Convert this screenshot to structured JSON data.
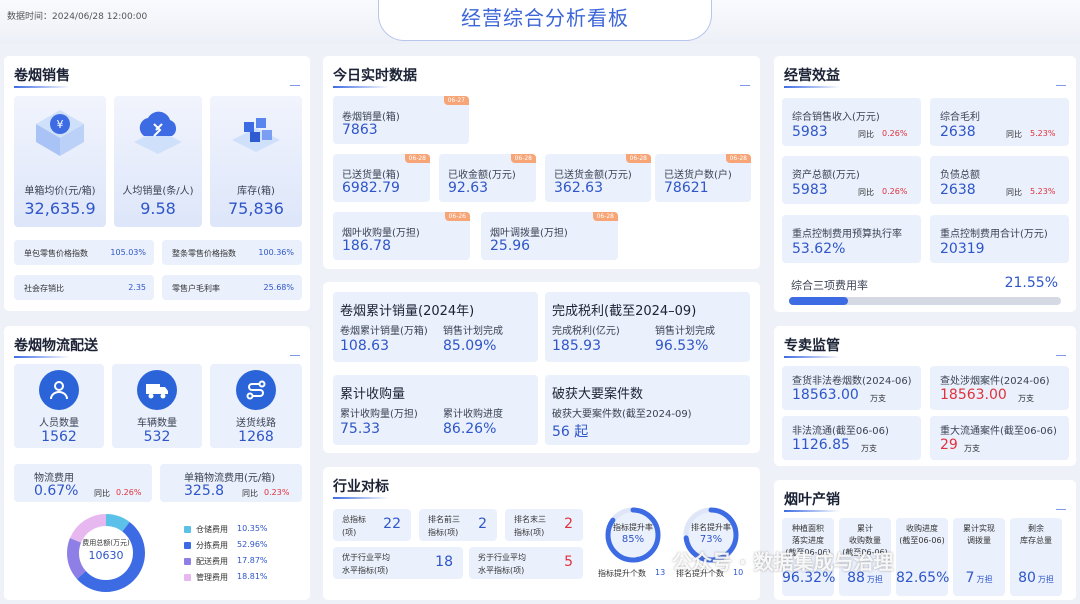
{
  "header": {
    "time_label": "数据时间：",
    "time_value": "2024/06/28  12:00:00",
    "title": "经营综合分析看板"
  },
  "sales": {
    "title": "卷烟销售",
    "kpis": [
      {
        "label": "单箱均价(元/箱)",
        "value": "32,635.9",
        "icon": "money-bag-icon"
      },
      {
        "label": "人均销量(条/人)",
        "value": "9.58",
        "icon": "cloud-icon"
      },
      {
        "label": "库存(箱)",
        "value": "75,836",
        "icon": "blocks-icon"
      }
    ],
    "indices": [
      {
        "label": "单包零售价格指数",
        "value": "105.03%"
      },
      {
        "label": "整条零售价格指数",
        "value": "100.36%"
      },
      {
        "label": "社会存销比",
        "value": "2.35"
      },
      {
        "label": "零售户毛利率",
        "value": "25.68%"
      }
    ]
  },
  "logistics": {
    "title": "卷烟物流配送",
    "kpis": [
      {
        "label": "人员数量",
        "value": "1562",
        "icon": "person-icon"
      },
      {
        "label": "车辆数量",
        "value": "532",
        "icon": "truck-icon"
      },
      {
        "label": "送货线路",
        "value": "1268",
        "icon": "route-icon"
      }
    ],
    "cost": {
      "label": "物流费用",
      "value": "0.67%",
      "yoy_label": "同比",
      "yoy": "0.26%"
    },
    "unit_cost": {
      "label": "单箱物流费用(元/箱)",
      "value": "325.8",
      "yoy_label": "同比",
      "yoy": "0.23%"
    },
    "donut": {
      "center_label": "费用总额(万元)",
      "center_value": "10630",
      "items": [
        {
          "name": "仓储费用",
          "value": "10.35%",
          "pct": 10.35,
          "color": "#5bc1e9"
        },
        {
          "name": "分拣费用",
          "value": "52.96%",
          "pct": 52.96,
          "color": "#3d6be3"
        },
        {
          "name": "配送费用",
          "value": "17.87%",
          "pct": 17.87,
          "color": "#8e7fe6"
        },
        {
          "name": "管理费用",
          "value": "18.81%",
          "pct": 18.81,
          "color": "#e7b7ef"
        }
      ]
    }
  },
  "realtime": {
    "title": "今日实时数据",
    "items": [
      {
        "label": "卷烟销量(箱)",
        "value": "7863",
        "tag": "06-27"
      },
      {
        "label": "已送货量(箱)",
        "value": "6982.79",
        "tag": "06-28"
      },
      {
        "label": "已收金额(万元)",
        "value": "92.63",
        "tag": "06-28"
      },
      {
        "label": "已送货金额(万元)",
        "value": "362.63",
        "tag": "06-28"
      },
      {
        "label": "已送货户数(户)",
        "value": "78621",
        "tag": "06-28"
      },
      {
        "label": "烟叶收购量(万担)",
        "value": "186.78",
        "tag": "06-26"
      },
      {
        "label": "烟叶调拨量(万担)",
        "value": "25.96",
        "tag": "06-28"
      }
    ]
  },
  "cumulative": [
    {
      "title": "卷烟累计销量(2024年)",
      "a_label": "卷烟累计销量(万箱)",
      "a_value": "108.63",
      "b_label": "销售计划完成",
      "b_value": "85.09%"
    },
    {
      "title": "完成税利(截至2024–09)",
      "a_label": "完成税利(亿元)",
      "a_value": "185.93",
      "b_label": "销售计划完成",
      "b_value": "96.53%"
    },
    {
      "title": "累计收购量",
      "a_label": "累计收购量(万担)",
      "a_value": "75.33",
      "b_label": "累计收购进度",
      "b_value": "86.26%"
    },
    {
      "title": "破获大要案件数",
      "a_label": "破获大要案件数(截至2024-09)",
      "a_value": "56 起"
    }
  ],
  "benchmark": {
    "title": "行业对标",
    "items": [
      {
        "label1": "总指标",
        "label2": "(项)",
        "value": "22",
        "color": "#2f56c9"
      },
      {
        "label1": "排名前三",
        "label2": "指标(项)",
        "value": "2",
        "color": "#2f56c9"
      },
      {
        "label1": "排名末三",
        "label2": "指标(项)",
        "value": "2",
        "color": "#e0323c"
      },
      {
        "label1": "优于行业平均",
        "label2": "水平指标(项)",
        "value": "18",
        "color": "#2f56c9"
      },
      {
        "label1": "劣于行业平均",
        "label2": "水平指标(项)",
        "value": "5",
        "color": "#e0323c"
      }
    ],
    "rings": [
      {
        "label": "指标提升率",
        "value": "85%",
        "pct": 85,
        "foot_label": "指标提升个数",
        "foot_value": "13"
      },
      {
        "label": "排名提升率",
        "value": "73%",
        "pct": 73,
        "foot_label": "排名提升个数",
        "foot_value": "10"
      }
    ]
  },
  "efficiency": {
    "title": "经营效益",
    "items": [
      {
        "label": "综合销售收入(万元)",
        "value": "5983",
        "yoy_label": "同比",
        "yoy": "0.26%"
      },
      {
        "label": "综合毛利",
        "value": "2638",
        "yoy_label": "同比",
        "yoy": "5.23%"
      },
      {
        "label": "资产总额(万元)",
        "value": "5983",
        "yoy_label": "同比",
        "yoy": "0.26%"
      },
      {
        "label": "负债总额",
        "value": "2638",
        "yoy_label": "同比",
        "yoy": "5.23%"
      },
      {
        "label": "重点控制费用预算执行率",
        "value": "53.62%"
      },
      {
        "label": "重点控制费用合计(万元)",
        "value": "20319"
      }
    ],
    "rate": {
      "label": "综合三项费用率",
      "value": "21.55%",
      "pct": 21.55
    }
  },
  "monopoly": {
    "title": "专卖监管",
    "items": [
      {
        "label": "查货非法卷烟数(2024-06)",
        "value": "18563.00",
        "unit": "万支",
        "red": false
      },
      {
        "label": "查处涉烟案件(2024-06)",
        "value": "18563.00",
        "unit": "万支",
        "red": true
      },
      {
        "label": "非法流通(截至06-06)",
        "value": "1126.85",
        "unit": "万支",
        "red": false
      },
      {
        "label": "重大流通案件(截至06-06)",
        "value": "29",
        "unit": "万支",
        "red": true
      }
    ]
  },
  "leaf": {
    "title": "烟叶产销",
    "items": [
      {
        "l1": "种植面积",
        "l2": "落实进度",
        "l3": "(截至06-06)",
        "value": "96.32%",
        "unit": ""
      },
      {
        "l1": "累计",
        "l2": "收购数量",
        "l3": "(截至06-06)",
        "value": "88",
        "unit": "万担"
      },
      {
        "l1": "收购进度",
        "l2": "(截至06-06)",
        "l3": "",
        "value": "82.65%",
        "unit": ""
      },
      {
        "l1": "累计实现",
        "l2": "调拨量",
        "l3": "",
        "value": "7",
        "unit": "万担"
      },
      {
        "l1": "剩余",
        "l2": "库存总量",
        "l3": "",
        "value": "80",
        "unit": "万担"
      }
    ]
  },
  "watermark": "公众号 · 数据集成与治理"
}
